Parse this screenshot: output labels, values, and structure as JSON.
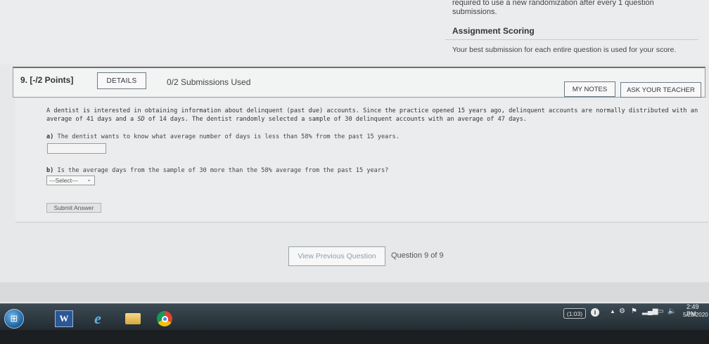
{
  "top": {
    "partial_line1": "required to use a new randomization after every 1 question",
    "partial_line2": "submissions.",
    "scoring_title": "Assignment Scoring",
    "scoring_text": "Your best submission for each entire question is used for your score."
  },
  "question": {
    "number": "9. [-/2 Points]",
    "details_label": "DETAILS",
    "submissions": "0/2 Submissions Used",
    "my_notes_label": "MY NOTES",
    "ask_teacher_label": "ASK YOUR TEACHER",
    "problem_part1": "A dentist is interested in obtaining information about delinquent (past due) accounts. Since the practice opened 15 years ago, delinquent accounts are normally distributed with an average of 41 days and a ",
    "problem_sd": "SD",
    "problem_part2": " of 14 days. The dentist randomly selected a sample of 30 delinquent accounts with an average of 47 days.",
    "part_a_label": "a)",
    "part_a_text": " The dentist wants to know what average number of days is less than 58% from the past 15 years.",
    "part_a_value": "",
    "part_b_label": "b)",
    "part_b_text": " Is the average days from the sample of 30 more than the 58% average from the past 15 years?",
    "select_value": "---Select---",
    "submit_label": "Submit Answer"
  },
  "nav": {
    "prev_label": "View Previous Question",
    "count": "Question 9 of 9"
  },
  "taskbar": {
    "word_label": "W",
    "ie_label": "e",
    "timer": "(1:03)",
    "info_label": "i",
    "up_label": "▲",
    "time": "2:49 PM",
    "date": "5/28/2020"
  }
}
